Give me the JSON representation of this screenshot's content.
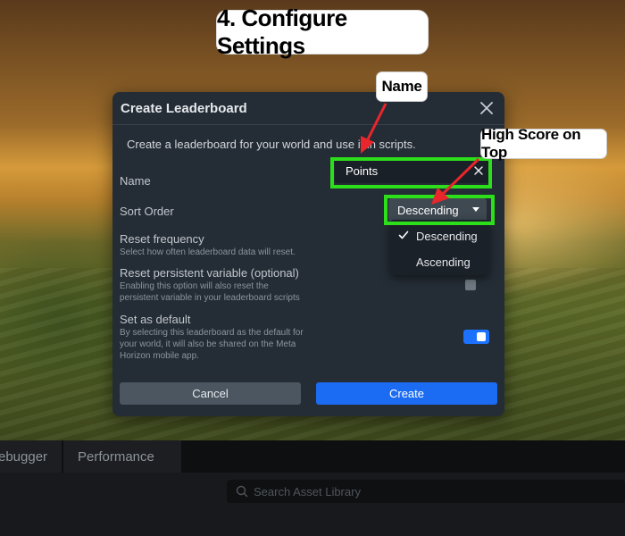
{
  "banner": {
    "title": "4. Configure Settings"
  },
  "dialog": {
    "title": "Create Leaderboard",
    "description": "Create a leaderboard for your world and use it in scripts.",
    "name": {
      "label": "Name",
      "value": "Points"
    },
    "sort_order": {
      "label": "Sort Order",
      "selected": "Descending",
      "options": [
        "Descending",
        "Ascending"
      ]
    },
    "reset_frequency": {
      "label": "Reset frequency",
      "help": "Select how often leaderboard data will reset."
    },
    "reset_persistent": {
      "label": "Reset persistent variable (optional)",
      "help_line1": "Enabling this option will also reset the",
      "help_line2": "persistent variable in your leaderboard scripts",
      "checked": false
    },
    "set_default": {
      "label": "Set as default",
      "help_line1": "By selecting this leaderboard as the default for",
      "help_line2": "your world, it will also be shared on the Meta",
      "help_line3": "Horizon mobile app.",
      "enabled": true
    },
    "buttons": {
      "cancel": "Cancel",
      "create": "Create"
    }
  },
  "annotations": {
    "name_callout": "Name",
    "sort_callout": "High Score on Top"
  },
  "editor": {
    "tabs": [
      "ebugger",
      "Performance"
    ],
    "search_placeholder": "Search Asset Library"
  },
  "colors": {
    "accent_blue": "#1b6cf2",
    "highlight_green": "#2dde1b",
    "arrow_red": "#e8262b",
    "dialog_bg": "#242c35"
  }
}
